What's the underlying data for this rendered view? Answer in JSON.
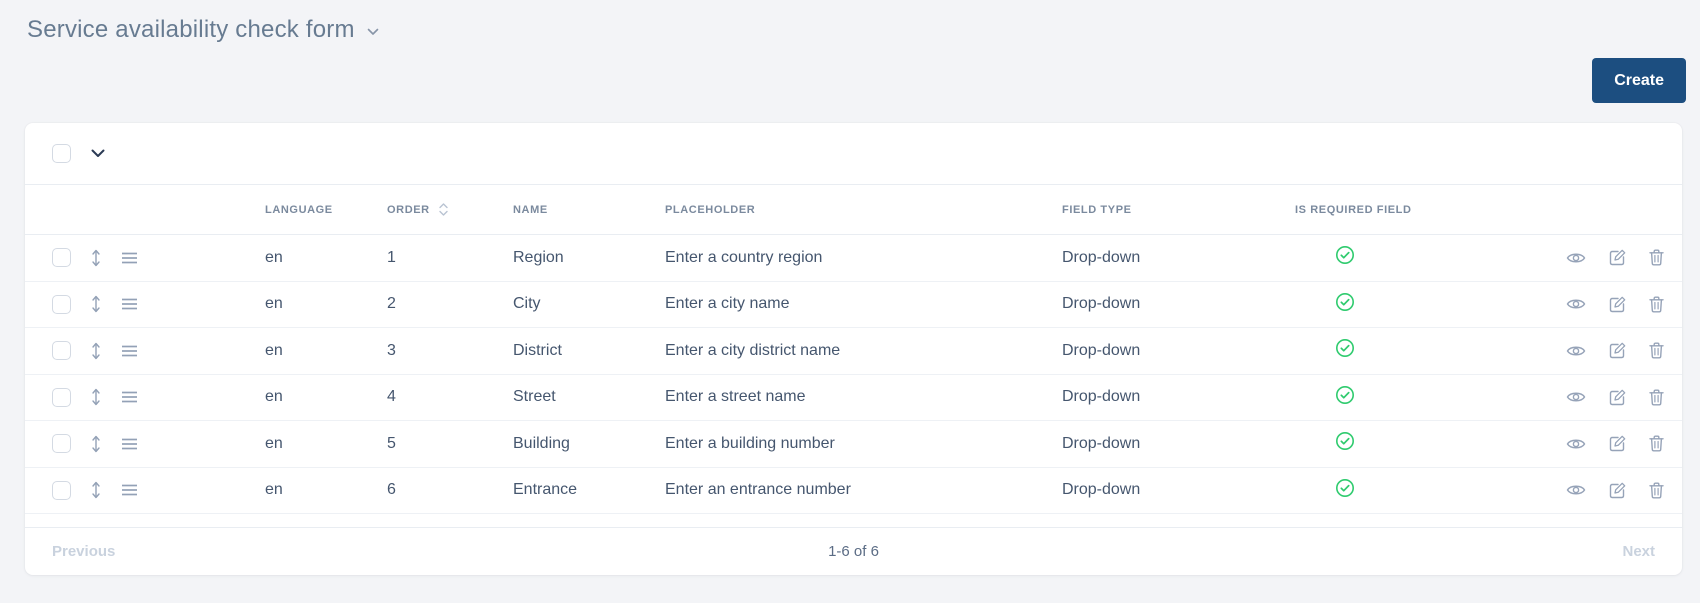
{
  "page": {
    "title": "Service availability check form"
  },
  "toolbar": {
    "create_label": "Create"
  },
  "table": {
    "headers": {
      "language": "LANGUAGE",
      "order": "ORDER",
      "name": "NAME",
      "placeholder": "PLACEHOLDER",
      "field_type": "FIELD TYPE",
      "is_required": "IS REQUIRED FIELD"
    },
    "rows": [
      {
        "language": "en",
        "order": "1",
        "name": "Region",
        "placeholder": "Enter a country region",
        "field_type": "Drop-down",
        "is_required": true
      },
      {
        "language": "en",
        "order": "2",
        "name": "City",
        "placeholder": "Enter a city name",
        "field_type": "Drop-down",
        "is_required": true
      },
      {
        "language": "en",
        "order": "3",
        "name": "District",
        "placeholder": "Enter a city district name",
        "field_type": "Drop-down",
        "is_required": true
      },
      {
        "language": "en",
        "order": "4",
        "name": "Street",
        "placeholder": "Enter a street name",
        "field_type": "Drop-down",
        "is_required": true
      },
      {
        "language": "en",
        "order": "5",
        "name": "Building",
        "placeholder": "Enter a building number",
        "field_type": "Drop-down",
        "is_required": true
      },
      {
        "language": "en",
        "order": "6",
        "name": "Entrance",
        "placeholder": "Enter an entrance number",
        "field_type": "Drop-down",
        "is_required": true
      }
    ],
    "row_icons": [
      "drag-vertical-icon",
      "row-menu-icon"
    ],
    "row_actions": [
      "view",
      "edit",
      "delete"
    ]
  },
  "pagination": {
    "previous_label": "Previous",
    "range_label": "1-6 of 6",
    "next_label": "Next"
  },
  "colors": {
    "accent": "#1c4e80",
    "success": "#2fcb6e",
    "background": "#f3f4f7",
    "title_text": "#677b91",
    "row_text": "#45566e",
    "header_text": "#7b8a9e"
  }
}
